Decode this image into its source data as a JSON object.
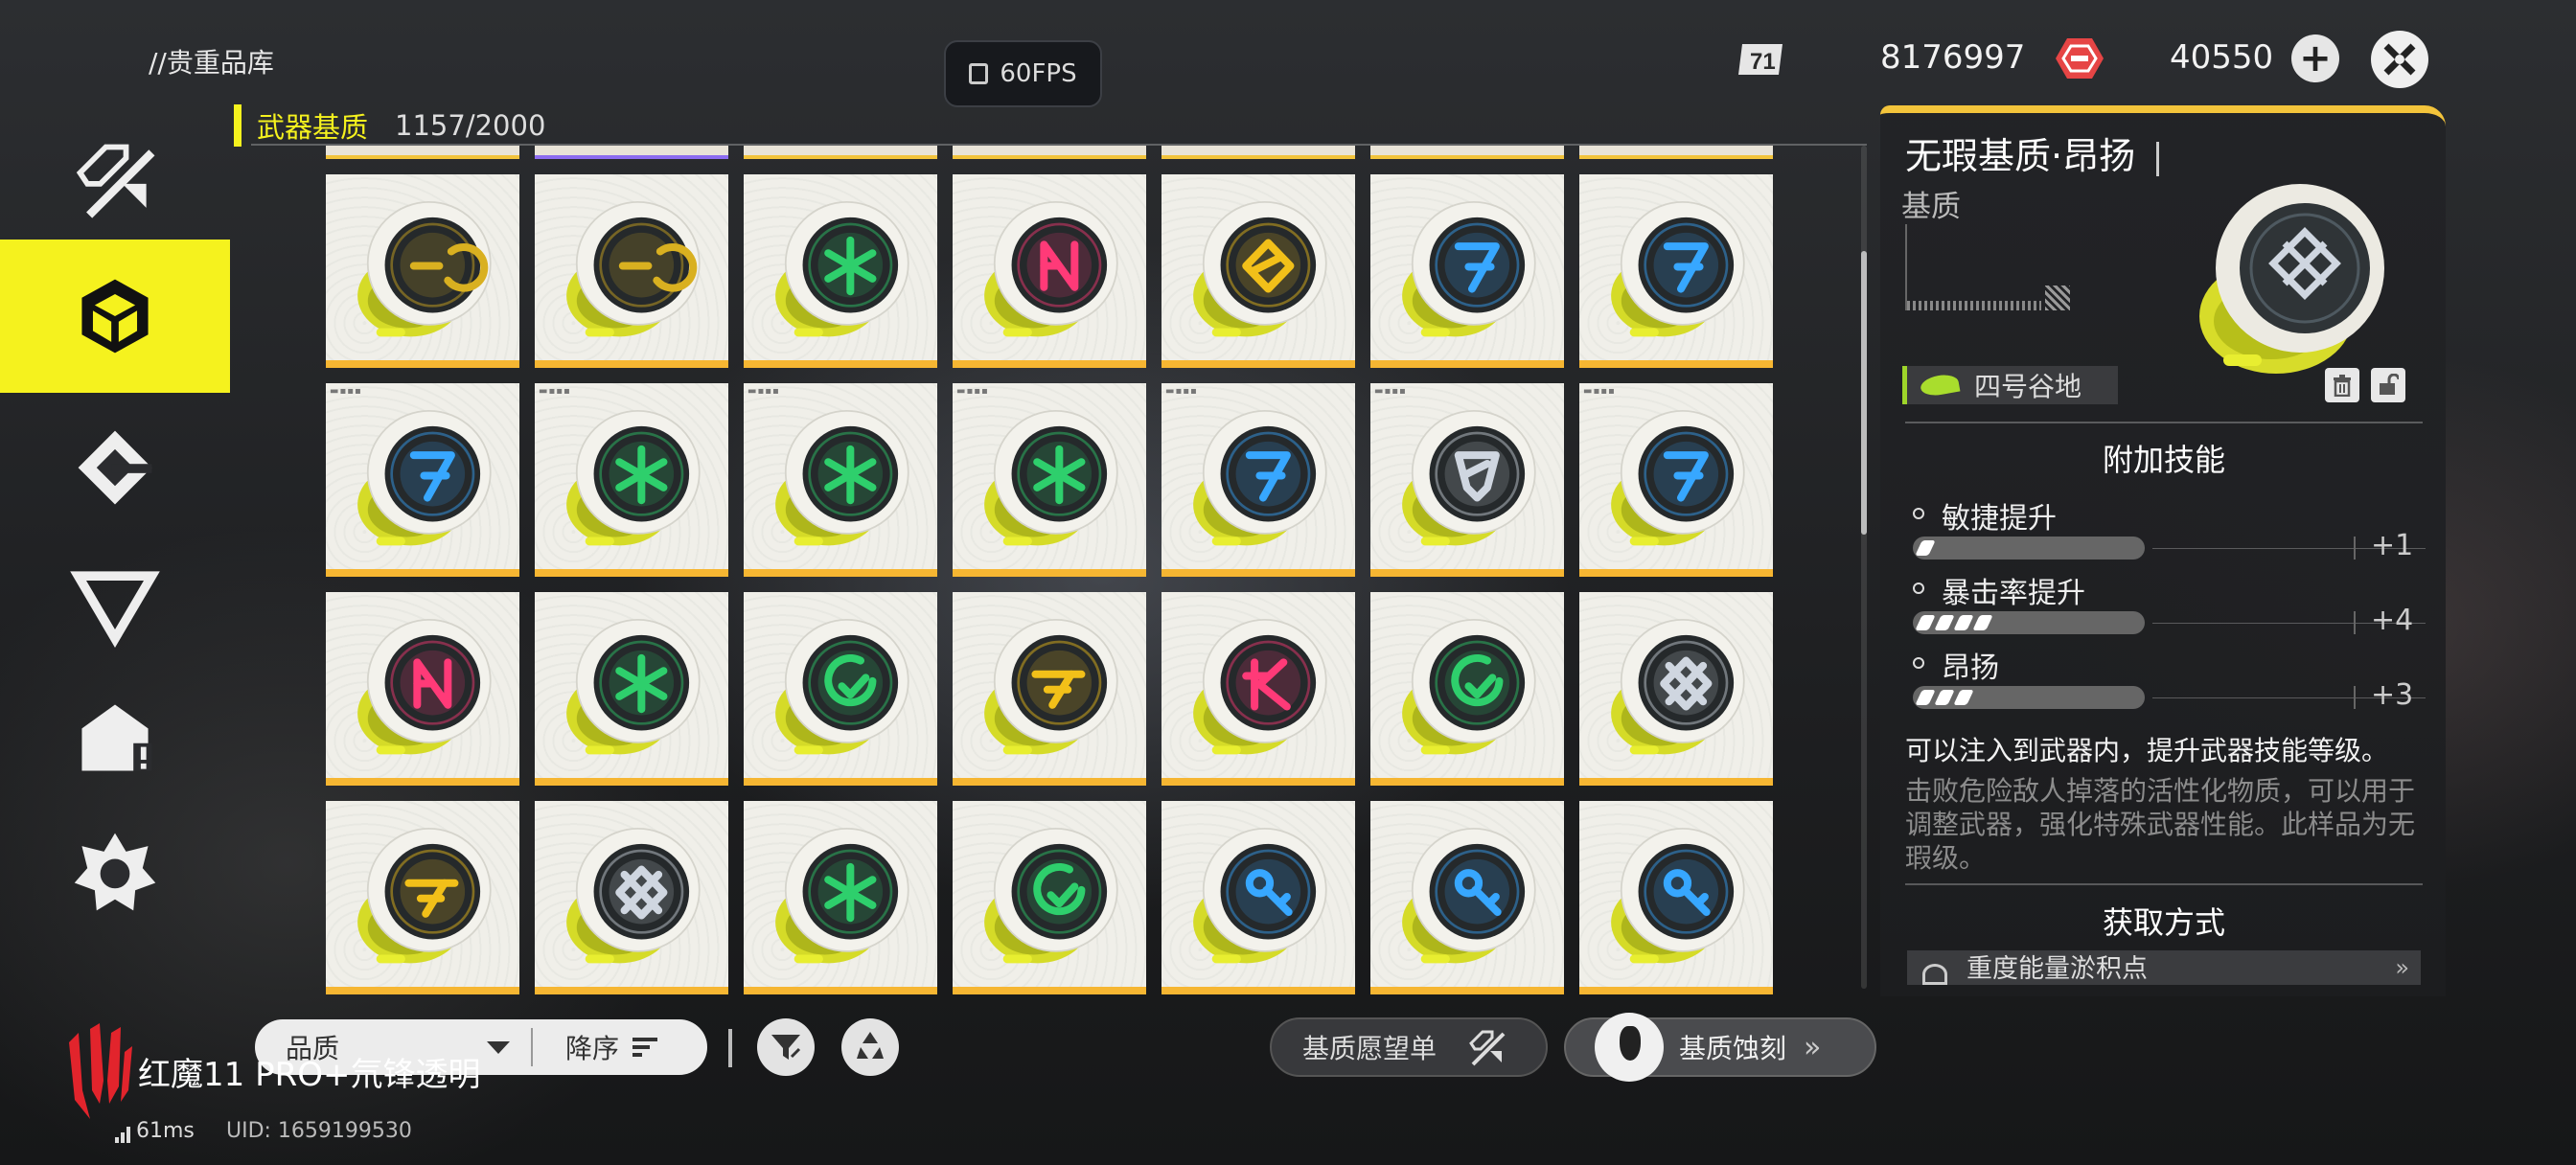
{
  "header": {
    "breadcrumb": "//贵重品库",
    "fps_label": "60FPS",
    "currency1_value": "8176997",
    "currency2_value": "40550",
    "plus_label": "+"
  },
  "category": {
    "name": "武器基质",
    "count": "1157/2000"
  },
  "sidebar": {
    "items": [
      {
        "icon": "weapon-icon",
        "active": false
      },
      {
        "icon": "cube-icon",
        "active": true
      },
      {
        "icon": "armor-icon",
        "active": false
      },
      {
        "icon": "triangle-icon",
        "active": false
      },
      {
        "icon": "package-icon",
        "active": false
      },
      {
        "icon": "gear-part-icon",
        "active": false
      }
    ]
  },
  "grid": {
    "prev_row": [
      {
        "rarity": "gold"
      },
      {
        "rarity": "purple"
      },
      {
        "rarity": "gold"
      },
      {
        "rarity": "gold"
      },
      {
        "rarity": "gold"
      },
      {
        "rarity": "gold"
      },
      {
        "rarity": "gold"
      }
    ],
    "rows": [
      [
        {
          "color": "#d9b020",
          "glyph": "C"
        },
        {
          "color": "#d9b020",
          "glyph": "C"
        },
        {
          "color": "#2ecf6c",
          "glyph": "star"
        },
        {
          "color": "#ff3a78",
          "glyph": "N"
        },
        {
          "color": "#f2c019",
          "glyph": "diamond"
        },
        {
          "color": "#37a7ff",
          "glyph": "7"
        },
        {
          "color": "#37a7ff",
          "glyph": "7"
        }
      ],
      [
        {
          "color": "#37a7ff",
          "glyph": "7",
          "tag": true
        },
        {
          "color": "#2ecf6c",
          "glyph": "star",
          "tag": true
        },
        {
          "color": "#2ecf6c",
          "glyph": "star",
          "tag": true
        },
        {
          "color": "#2ecf6c",
          "glyph": "star",
          "tag": true
        },
        {
          "color": "#37a7ff",
          "glyph": "7",
          "tag": true
        },
        {
          "color": "#cfd6e0",
          "glyph": "shield",
          "tag": true
        },
        {
          "color": "#37a7ff",
          "glyph": "7",
          "tag": true
        }
      ],
      [
        {
          "color": "#ff3a78",
          "glyph": "N"
        },
        {
          "color": "#2ecf6c",
          "glyph": "star"
        },
        {
          "color": "#2ecf6c",
          "glyph": "arc"
        },
        {
          "color": "#f2c019",
          "glyph": "slash"
        },
        {
          "color": "#ff3a78",
          "glyph": "K"
        },
        {
          "color": "#2ecf6c",
          "glyph": "arc"
        },
        {
          "color": "#cfd6e0",
          "glyph": "x"
        }
      ],
      [
        {
          "color": "#f2c019",
          "glyph": "slash"
        },
        {
          "color": "#cfd6e0",
          "glyph": "x"
        },
        {
          "color": "#2ecf6c",
          "glyph": "star"
        },
        {
          "color": "#2ecf6c",
          "glyph": "arc"
        },
        {
          "color": "#37a7ff",
          "glyph": "key"
        },
        {
          "color": "#37a7ff",
          "glyph": "key"
        },
        {
          "color": "#37a7ff",
          "glyph": "key"
        }
      ]
    ]
  },
  "detail": {
    "title": "无瑕基质·昂扬",
    "subtitle": "基质",
    "location": "四号谷地",
    "skills_title": "附加技能",
    "skills": [
      {
        "name": "敏捷提升",
        "pips": 1,
        "level": "+1"
      },
      {
        "name": "暴击率提升",
        "pips": 4,
        "level": "+4"
      },
      {
        "name": "昂扬",
        "pips": 3,
        "level": "+3"
      }
    ],
    "effect": "可以注入到武器内，提升武器技能等级。",
    "flavor": "击败危险敌人掉落的活性化物质，可以用于调整武器，强化特殊武器性能。此样品为无瑕级。",
    "acquire_title": "获取方式",
    "acquire_item": "重度能量淤积点",
    "acquire_arrow": "»"
  },
  "toolbar": {
    "sort_field": "品质",
    "sort_order": "降序",
    "wishlist_label": "基质愿望单",
    "etch_label": "基质蚀刻",
    "etch_arrow": "»"
  },
  "device": {
    "brand": "红魔11 PRO+氘锋透明",
    "ping": "61ms",
    "uid": "UID: 1659199530"
  },
  "colors": {
    "accent_yellow": "#f5f21e",
    "rarity_gold": "#f6b632",
    "rarity_purple": "#8d6cf0"
  }
}
